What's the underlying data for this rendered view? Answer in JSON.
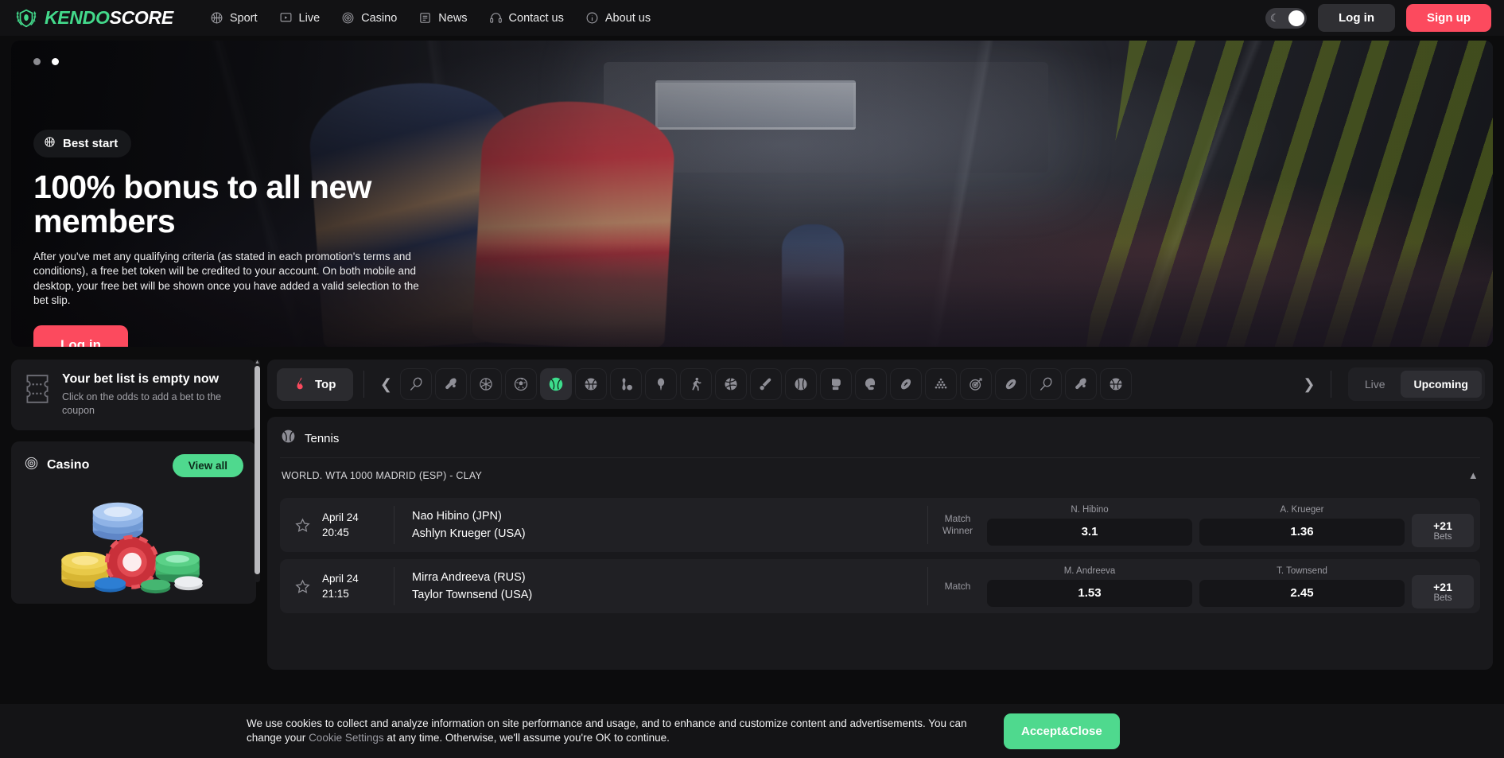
{
  "header": {
    "logo": {
      "first": "KENDO",
      "second": "SCORE",
      "icon": "shield-laurel-icon"
    },
    "nav": [
      {
        "label": "Sport",
        "icon": "basketball-icon"
      },
      {
        "label": "Live",
        "icon": "monitor-play-icon"
      },
      {
        "label": "Casino",
        "icon": "target-circle-icon"
      },
      {
        "label": "News",
        "icon": "newspaper-icon"
      },
      {
        "label": "Contact us",
        "icon": "headset-icon"
      },
      {
        "label": "About us",
        "icon": "info-circle-icon"
      }
    ],
    "theme_toggle": {
      "icon": "moon-icon",
      "state": "dark"
    },
    "login_label": "Log in",
    "signup_label": "Sign up"
  },
  "hero": {
    "badge": {
      "label": "Best start",
      "icon": "basketball-icon"
    },
    "title": "100% bonus to all new members",
    "description": "After you've met any qualifying criteria (as stated in each promotion's terms and conditions), a free bet token will be credited to your account. On both mobile and desktop, your free bet will be shown once you have added a valid selection to the bet slip.",
    "cta_label": "Log in",
    "slides": 2,
    "active_slide": 2
  },
  "sidebar": {
    "betlist": {
      "icon": "ticket-icon",
      "title": "Your bet list is empty now",
      "subtitle": "Click on the odds to add a bet to the coupon"
    },
    "casino": {
      "icon": "target-circle-icon",
      "title": "Casino",
      "view_all_label": "View all",
      "art": "casino-chips-illustration"
    }
  },
  "sports_bar": {
    "top_label": "Top",
    "top_icon": "flame-icon",
    "prev_icon": "chevron-left-icon",
    "next_icon": "chevron-right-icon",
    "icons": [
      {
        "name": "tennis-racket-icon",
        "active": false
      },
      {
        "name": "table-tennis-icon",
        "active": false
      },
      {
        "name": "volleyball-icon",
        "active": false
      },
      {
        "name": "soccer-ball-icon",
        "active": false
      },
      {
        "name": "tennis-ball-icon",
        "active": true
      },
      {
        "name": "basketball-icon",
        "active": false
      },
      {
        "name": "bowling-icon",
        "active": false
      },
      {
        "name": "golf-tee-icon",
        "active": false
      },
      {
        "name": "handball-icon",
        "active": false
      },
      {
        "name": "volleyball-alt-icon",
        "active": false
      },
      {
        "name": "cricket-icon",
        "active": false
      },
      {
        "name": "baseball-icon",
        "active": false
      },
      {
        "name": "boxing-glove-icon",
        "active": false
      },
      {
        "name": "american-football-helmet-icon",
        "active": false
      },
      {
        "name": "rugby-ball-icon",
        "active": false
      },
      {
        "name": "snooker-rack-icon",
        "active": false
      },
      {
        "name": "darts-target-icon",
        "active": false
      },
      {
        "name": "american-football-icon",
        "active": false
      },
      {
        "name": "badminton-racket-icon",
        "active": false
      },
      {
        "name": "table-tennis-paddle-icon",
        "active": false
      },
      {
        "name": "basketball-alt-icon",
        "active": false
      }
    ],
    "live_label": "Live",
    "upcoming_label": "Upcoming",
    "active_filter": "Upcoming"
  },
  "content": {
    "sport_name": "Tennis",
    "sport_icon": "tennis-ball-icon",
    "league": "WORLD. WTA 1000 MADRID (ESP) - CLAY",
    "collapse_icon": "chevron-up-icon",
    "matches": [
      {
        "star_icon": "star-outline-icon",
        "date": "April 24",
        "time": "20:45",
        "team_home": "Nao Hibino (JPN)",
        "team_away": "Ashlyn Krueger (USA)",
        "market": "Match Winner",
        "odds": [
          {
            "label": "N. Hibino",
            "value": "3.1"
          },
          {
            "label": "A. Krueger",
            "value": "1.36"
          }
        ],
        "more_count": "+21",
        "more_label": "Bets"
      },
      {
        "star_icon": "star-outline-icon",
        "date": "April 24",
        "time": "21:15",
        "team_home": "Mirra Andreeva (RUS)",
        "team_away": "Taylor Townsend (USA)",
        "market": "Match",
        "odds": [
          {
            "label": "M. Andreeva",
            "value": "1.53"
          },
          {
            "label": "T. Townsend",
            "value": "2.45"
          }
        ],
        "more_count": "+21",
        "more_label": "Bets"
      }
    ]
  },
  "cookie": {
    "text_before": "We use cookies to collect and analyze information on site performance and usage, and to enhance and customize content and advertisements. You can change your ",
    "link": "Cookie Settings",
    "text_after": " at any time. Otherwise, we'll assume you're OK to continue.",
    "accept_label": "Accept&Close"
  },
  "colors": {
    "brand_green": "#43d98b",
    "accent_red": "#fc4a5e",
    "panel": "#19191c",
    "background": "#0c0c0d"
  }
}
